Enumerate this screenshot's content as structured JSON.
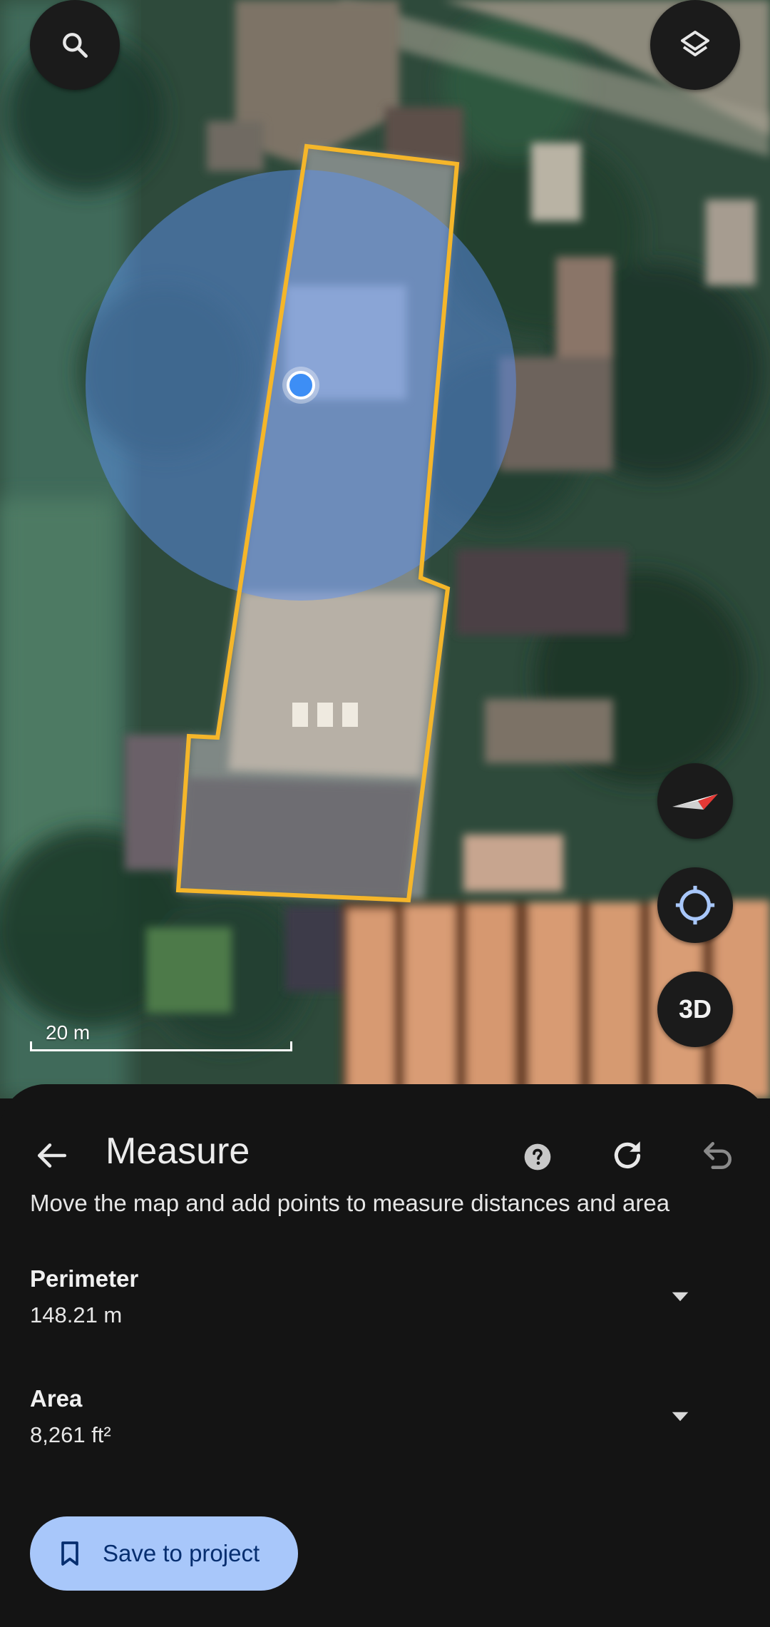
{
  "map": {
    "scale_label": "20 m",
    "threed_label": "3D",
    "measured_polygon_color": "#f5b62a",
    "accuracy_circle_color": "#5b8ff0",
    "location_dot_color": "#3d8ef5"
  },
  "sheet": {
    "title": "Measure",
    "instructions": "Move the map and add points to measure distances and area",
    "perimeter": {
      "label": "Perimeter",
      "value": "148.21 m"
    },
    "area": {
      "label": "Area",
      "value": "8,261 ft²"
    },
    "save_label": "Save to project"
  },
  "icons": [
    "search-icon",
    "layers-icon",
    "compass-icon",
    "my-location-icon",
    "back-arrow-icon",
    "help-icon",
    "refresh-icon",
    "undo-icon",
    "chevron-down-icon",
    "bookmark-icon"
  ],
  "colors": {
    "accent_button": "#a8c7fa",
    "accent_button_text": "#062e6f",
    "sheet_bg": "#141414"
  }
}
